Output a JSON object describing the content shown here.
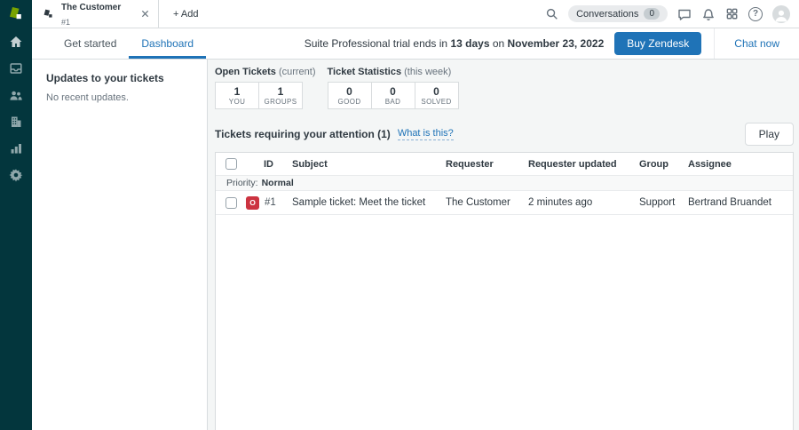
{
  "colors": {
    "accent": "#1f73b7",
    "sidebar": "#03363d",
    "logo_green": "#78a300",
    "open_status": "#cc3340"
  },
  "sidebar": {
    "icons": [
      "home-icon",
      "views-icon",
      "customers-icon",
      "organizations-icon",
      "reporting-icon",
      "admin-icon"
    ]
  },
  "topbar": {
    "tab": {
      "title": "The Customer",
      "subtitle": "#1"
    },
    "add_label": "+ Add",
    "conversations_label": "Conversations",
    "conversations_count": "0",
    "help_glyph": "?"
  },
  "subheader": {
    "tabs": [
      {
        "label": "Get started"
      },
      {
        "label": "Dashboard"
      }
    ],
    "trial_prefix": "Suite Professional trial ends in ",
    "trial_days": "13 days",
    "trial_mid": " on ",
    "trial_date": "November 23, 2022",
    "buy_label": "Buy Zendesk",
    "chat_label": "Chat now"
  },
  "updates_panel": {
    "title": "Updates to your tickets",
    "empty_message": "No recent updates."
  },
  "stats": {
    "groups": [
      {
        "title": "Open Tickets",
        "subtitle": " (current)",
        "items": [
          {
            "value": "1",
            "label": "YOU"
          },
          {
            "value": "1",
            "label": "GROUPS"
          }
        ]
      },
      {
        "title": "Ticket Statistics",
        "subtitle": " (this week)",
        "items": [
          {
            "value": "0",
            "label": "GOOD"
          },
          {
            "value": "0",
            "label": "BAD"
          },
          {
            "value": "0",
            "label": "SOLVED"
          }
        ]
      }
    ]
  },
  "tickets": {
    "heading": "Tickets requiring your attention (1)",
    "help_link": "What is this?",
    "play_label": "Play",
    "columns": [
      "ID",
      "Subject",
      "Requester",
      "Requester updated",
      "Group",
      "Assignee"
    ],
    "group_row": {
      "label": "Priority:",
      "value": "Normal"
    },
    "rows": [
      {
        "status": "O",
        "id": "#1",
        "subject": "Sample ticket: Meet the ticket",
        "requester": "The Customer",
        "updated": "2 minutes ago",
        "group": "Support",
        "assignee": "Bertrand Bruandet"
      }
    ]
  }
}
